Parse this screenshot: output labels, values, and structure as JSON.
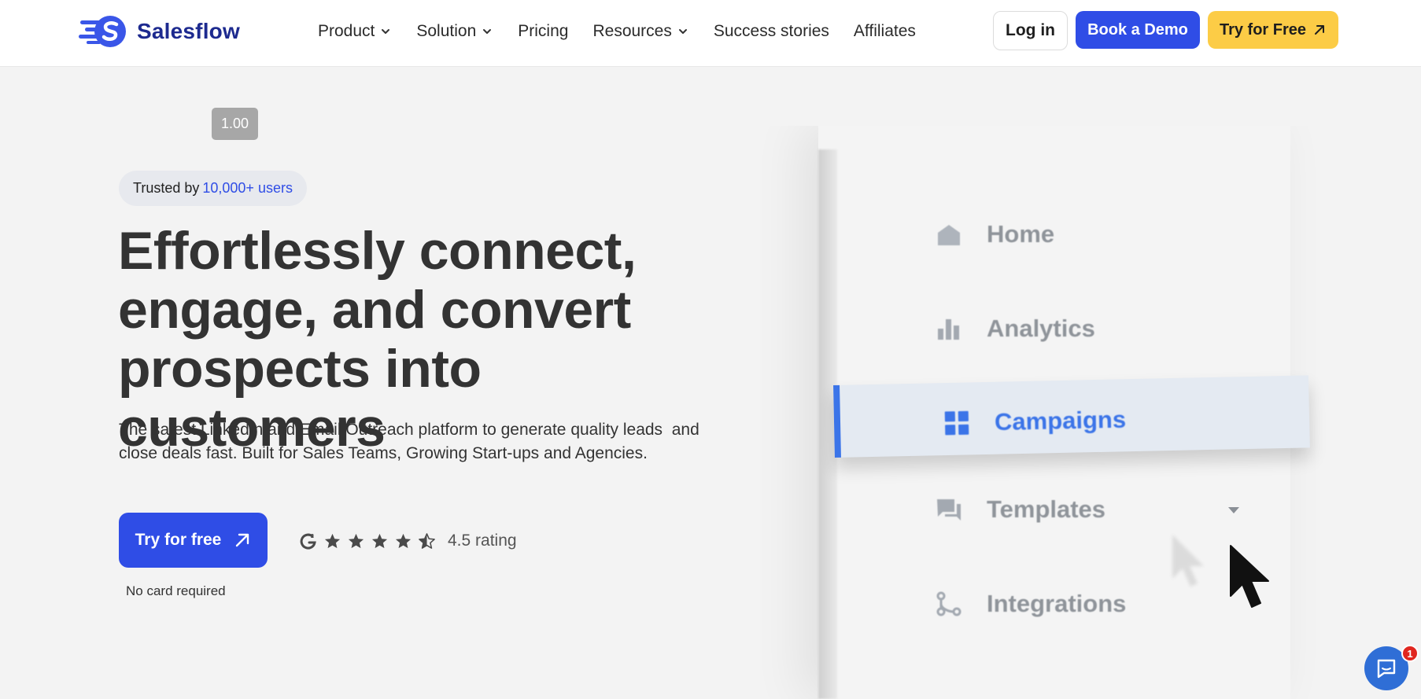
{
  "header": {
    "brand": "Salesflow",
    "nav": [
      {
        "label": "Product",
        "dropdown": true
      },
      {
        "label": "Solution",
        "dropdown": true
      },
      {
        "label": "Pricing",
        "dropdown": false
      },
      {
        "label": "Resources",
        "dropdown": true
      },
      {
        "label": "Success stories",
        "dropdown": false
      },
      {
        "label": "Affiliates",
        "dropdown": false
      }
    ],
    "login_label": "Log in",
    "demo_label": "Book a Demo",
    "try_label": "Try for Free"
  },
  "zoom_chip": "1.00",
  "hero": {
    "trust_prefix": "Trusted by",
    "trust_highlight": "10,000+ users",
    "title_lines": [
      "Effortlessly connect,",
      "engage, and convert",
      "prospects into customers"
    ],
    "subtitle_lines": [
      "The safest LinkedIn and Email Outreach platform to generate quality leads  and",
      "close deals fast. Built for Sales Teams, Growing Start-ups and Agencies."
    ],
    "cta_label": "Try for free",
    "no_card": "No card required",
    "rating_value": 4.5,
    "rating_text": "4.5 rating"
  },
  "visual_menu": {
    "items": [
      "Home",
      "Analytics",
      "Campaigns",
      "Templates",
      "Integrations"
    ],
    "active": "Campaigns"
  },
  "chat": {
    "badge_count": "1"
  },
  "colors": {
    "brand_blue": "#2f4de6",
    "brand_navy": "#1d2a8f",
    "try_yellow": "#fccc46",
    "accent_blue": "#3b74e8",
    "badge_red": "#e0261f"
  }
}
